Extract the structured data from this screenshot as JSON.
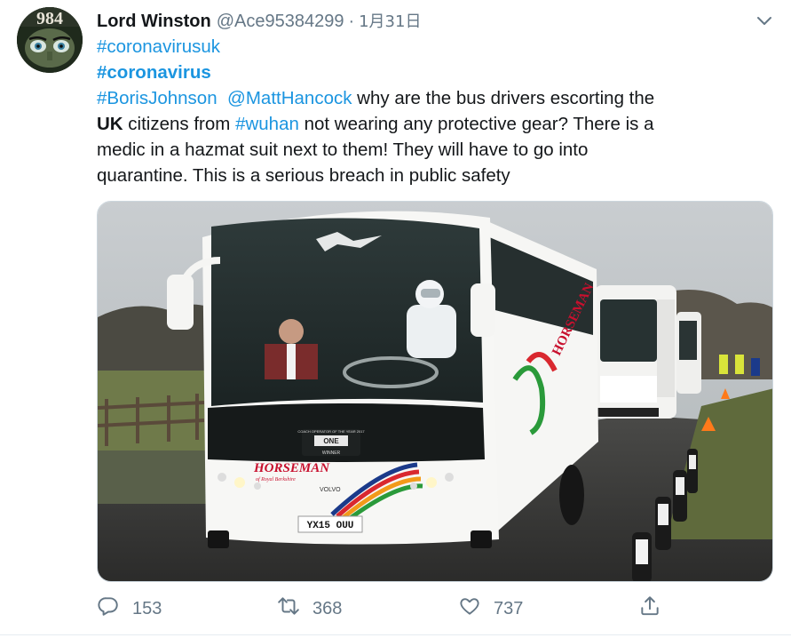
{
  "tweet": {
    "display_name": "Lord Winston",
    "handle": "@Ace95384299",
    "separator": "·",
    "timestamp": "1月31日",
    "avatar_text": "984",
    "lines": {
      "l1_tag": "#coronavirusuk",
      "l2_tag": "#coronavirus",
      "l3_tag1": "#BorisJohnson",
      "l3_tag2": "@MattHancock",
      "l3_text": " why are the bus drivers escorting the",
      "l4_strong": "UK",
      "l4_text1": " citizens from ",
      "l4_tag": "#wuhan",
      "l4_text2": " not wearing any protective gear? There is a",
      "l5_text": "medic in a hazmat suit next to them! They will have to go into",
      "l6_text": "quarantine. This is a serious breach in public safety"
    },
    "media": {
      "bus_brand": "HORSEMAN",
      "bus_brand_sub": "of Royal Berkshire",
      "bus_make": "VOLVO",
      "plate": "YX15 OUU",
      "award_top": "COACH OPERATOR OF THE YEAR 2017",
      "award_mid": "ONE",
      "award_bottom": "WINNER",
      "side_brand": "HORSEMAN"
    },
    "actions": {
      "reply_count": "153",
      "retweet_count": "368",
      "like_count": "737"
    }
  },
  "colors": {
    "link": "#1b95e0",
    "muted": "#657786",
    "text": "#14171a",
    "brand_red": "#c8102e"
  },
  "icons": [
    "chevron-down-icon",
    "reply-icon",
    "retweet-icon",
    "like-icon",
    "share-icon"
  ]
}
